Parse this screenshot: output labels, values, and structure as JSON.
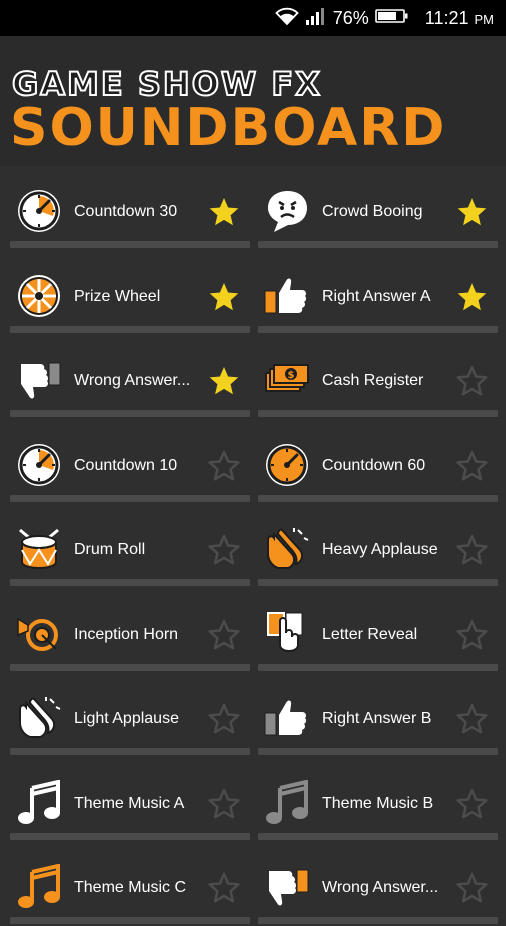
{
  "status_bar": {
    "battery": "76%",
    "time": "11:21",
    "ampm": "PM"
  },
  "header": {
    "title_line1": "GAME SHOW FX",
    "title_line2": "SOUNDBOARD"
  },
  "colors": {
    "accent": "#f5921e",
    "star_on": "#f2d21e",
    "star_off": "#4c4c4c",
    "background": "#2f2f2f"
  },
  "sounds": [
    {
      "label": "Countdown 30",
      "icon": "stopwatch-icon",
      "favorite": true
    },
    {
      "label": "Crowd Booing",
      "icon": "angry-speech-bubble-icon",
      "favorite": true
    },
    {
      "label": "Prize Wheel",
      "icon": "prize-wheel-icon",
      "favorite": true
    },
    {
      "label": "Right Answer A",
      "icon": "thumbs-up-icon",
      "favorite": true
    },
    {
      "label": "Wrong Answer...",
      "icon": "thumbs-down-icon",
      "favorite": true
    },
    {
      "label": "Cash Register",
      "icon": "cash-stack-icon",
      "favorite": false
    },
    {
      "label": "Countdown 10",
      "icon": "stopwatch-icon",
      "favorite": false
    },
    {
      "label": "Countdown 60",
      "icon": "stopwatch-orange-icon",
      "favorite": false
    },
    {
      "label": "Drum Roll",
      "icon": "drum-icon",
      "favorite": false
    },
    {
      "label": "Heavy Applause",
      "icon": "clapping-hands-orange-icon",
      "favorite": false
    },
    {
      "label": "Inception Horn",
      "icon": "horn-icon",
      "favorite": false
    },
    {
      "label": "Letter Reveal",
      "icon": "letter-reveal-hand-icon",
      "favorite": false
    },
    {
      "label": "Light Applause",
      "icon": "clapping-hands-icon",
      "favorite": false
    },
    {
      "label": "Right Answer B",
      "icon": "thumbs-up-gray-icon",
      "favorite": false
    },
    {
      "label": "Theme Music A",
      "icon": "music-note-icon",
      "favorite": false
    },
    {
      "label": "Theme Music B",
      "icon": "music-note-gray-icon",
      "favorite": false
    },
    {
      "label": "Theme Music C",
      "icon": "music-note-orange-icon",
      "favorite": false
    },
    {
      "label": "Wrong Answer...",
      "icon": "thumbs-down-orange-icon",
      "favorite": false
    }
  ]
}
